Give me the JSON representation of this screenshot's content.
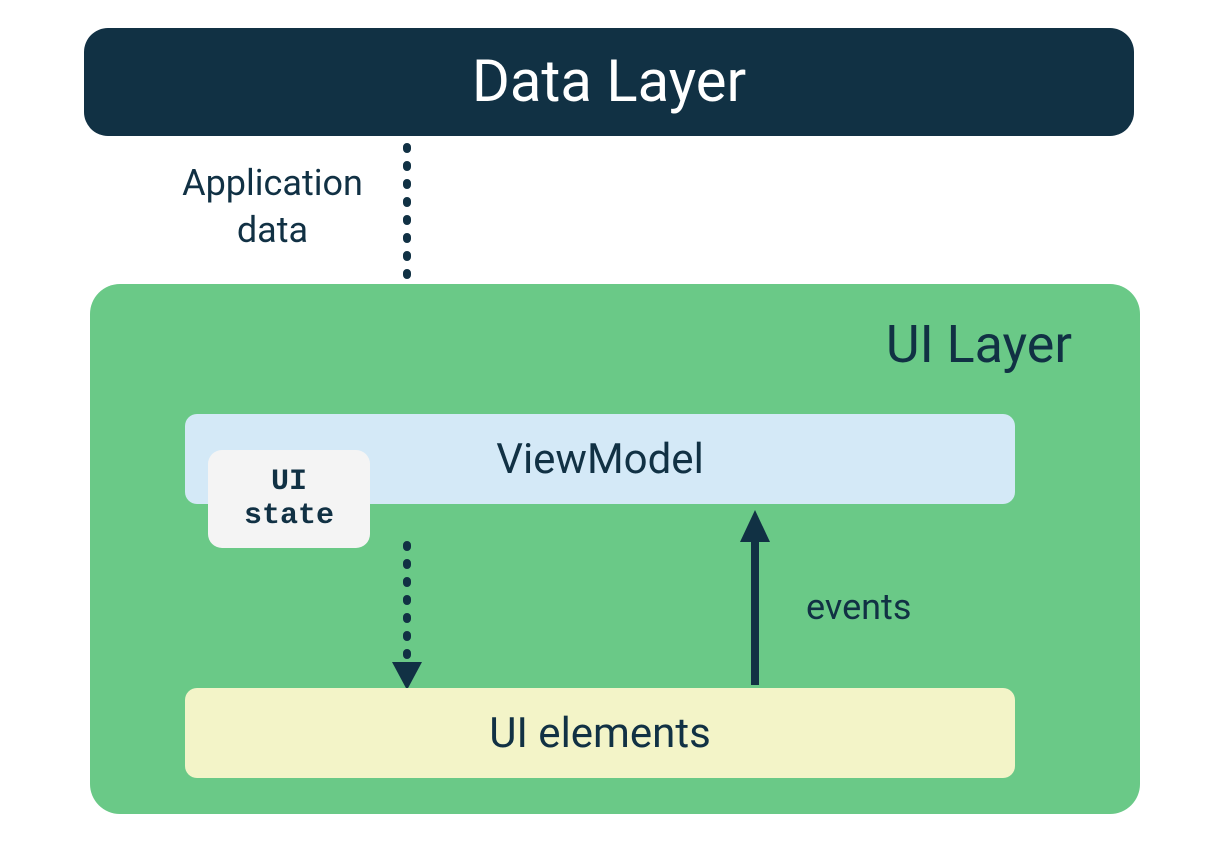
{
  "diagram": {
    "dataLayer": {
      "label": "Data Layer"
    },
    "appDataArrow": {
      "label": "Application data"
    },
    "uiLayer": {
      "label": "UI Layer",
      "viewModel": {
        "label": "ViewModel"
      },
      "uiState": {
        "line1": "UI",
        "line2": "state"
      },
      "uiElements": {
        "label": "UI elements"
      },
      "eventsArrow": {
        "label": "events"
      }
    }
  },
  "colors": {
    "dataLayerBg": "#113144",
    "uiLayerBg": "#6ac987",
    "viewModelBg": "#d4e9f7",
    "uiStateBg": "#f4f4f4",
    "uiElementsBg": "#f3f4c8",
    "textDark": "#113144",
    "textLight": "#ffffff"
  }
}
